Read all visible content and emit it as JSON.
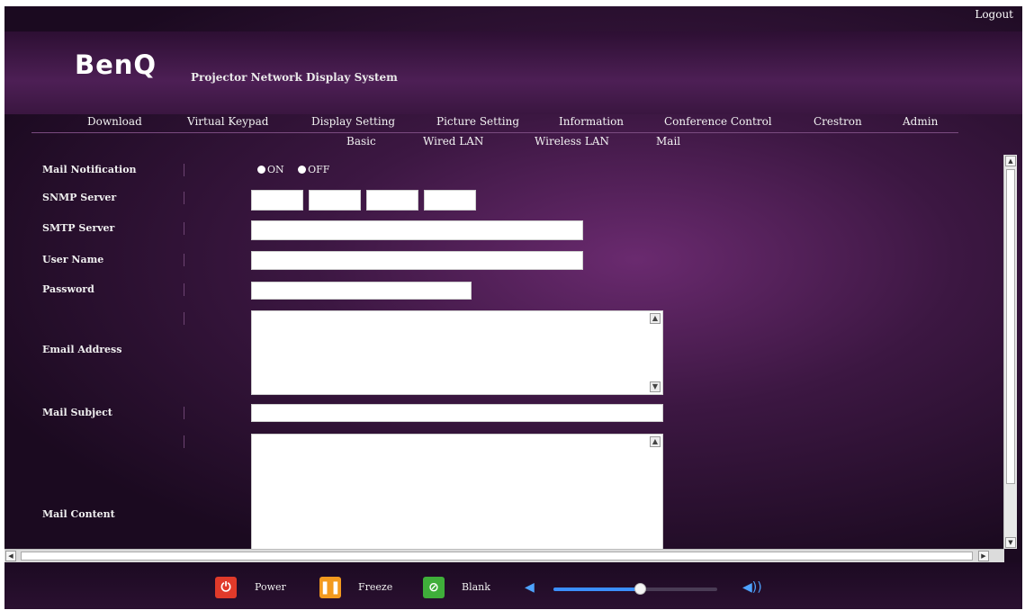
{
  "header": {
    "logout": "Logout",
    "logo": "BenQ",
    "subtitle": "Projector Network Display System"
  },
  "nav": {
    "items": [
      "Download",
      "Virtual Keypad",
      "Display Setting",
      "Picture Setting",
      "Information",
      "Conference Control",
      "Crestron",
      "Admin"
    ]
  },
  "subnav": {
    "items": [
      "Basic",
      "Wired LAN",
      "Wireless LAN",
      "Mail"
    ]
  },
  "form": {
    "mail_notification": {
      "label": "Mail Notification",
      "on": "ON",
      "off": "OFF"
    },
    "snmp_server": {
      "label": "SNMP Server",
      "values": [
        "",
        "",
        "",
        ""
      ]
    },
    "smtp_server": {
      "label": "SMTP Server",
      "value": ""
    },
    "user_name": {
      "label": "User Name",
      "value": ""
    },
    "password": {
      "label": "Password",
      "value": ""
    },
    "email_address": {
      "label": "Email Address",
      "value": ""
    },
    "mail_subject": {
      "label": "Mail Subject",
      "value": ""
    },
    "mail_content": {
      "label": "Mail Content",
      "value": ""
    }
  },
  "controls": {
    "power": "Power",
    "freeze": "Freeze",
    "blank": "Blank",
    "volume_level": 0.53
  },
  "colors": {
    "accent": "#3b8fff",
    "power": "#e03a2a",
    "freeze": "#f39a1e",
    "blank": "#3fae3a"
  }
}
